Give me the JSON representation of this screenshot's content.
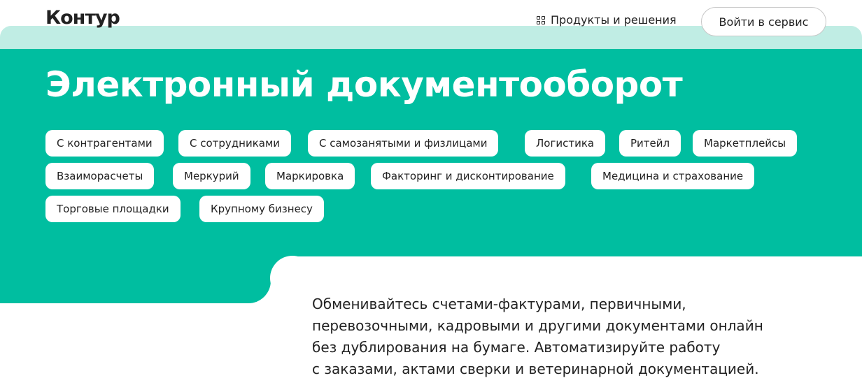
{
  "header": {
    "logo": "Контур",
    "products_label": "Продукты и решения",
    "login_label": "Войти в сервис"
  },
  "hero": {
    "title": "Электронный документооборот",
    "chips": [
      "С контрагентами",
      "С сотрудниками",
      "С самозанятыми и физлицами",
      "Логистика",
      "Ритейл",
      "Маркетплейсы",
      "Взаиморасчеты",
      "Меркурий",
      "Маркировка",
      "Факторинг и дисконтирование",
      "Медицина и страхование",
      "Торговые площадки",
      "Крупному бизнесу"
    ]
  },
  "description": {
    "lines": [
      "Обменивайтесь счетами-фактурами, первичными,",
      "перевозочными, кадровыми и другими документами онлайн",
      "без дублирования на бумаге. Автоматизируйте работу",
      "с заказами, актами сверки и ветеринарной документацией."
    ]
  },
  "colors": {
    "accent": "#00bea0",
    "accent_light": "#c0ede4",
    "text": "#222222"
  }
}
